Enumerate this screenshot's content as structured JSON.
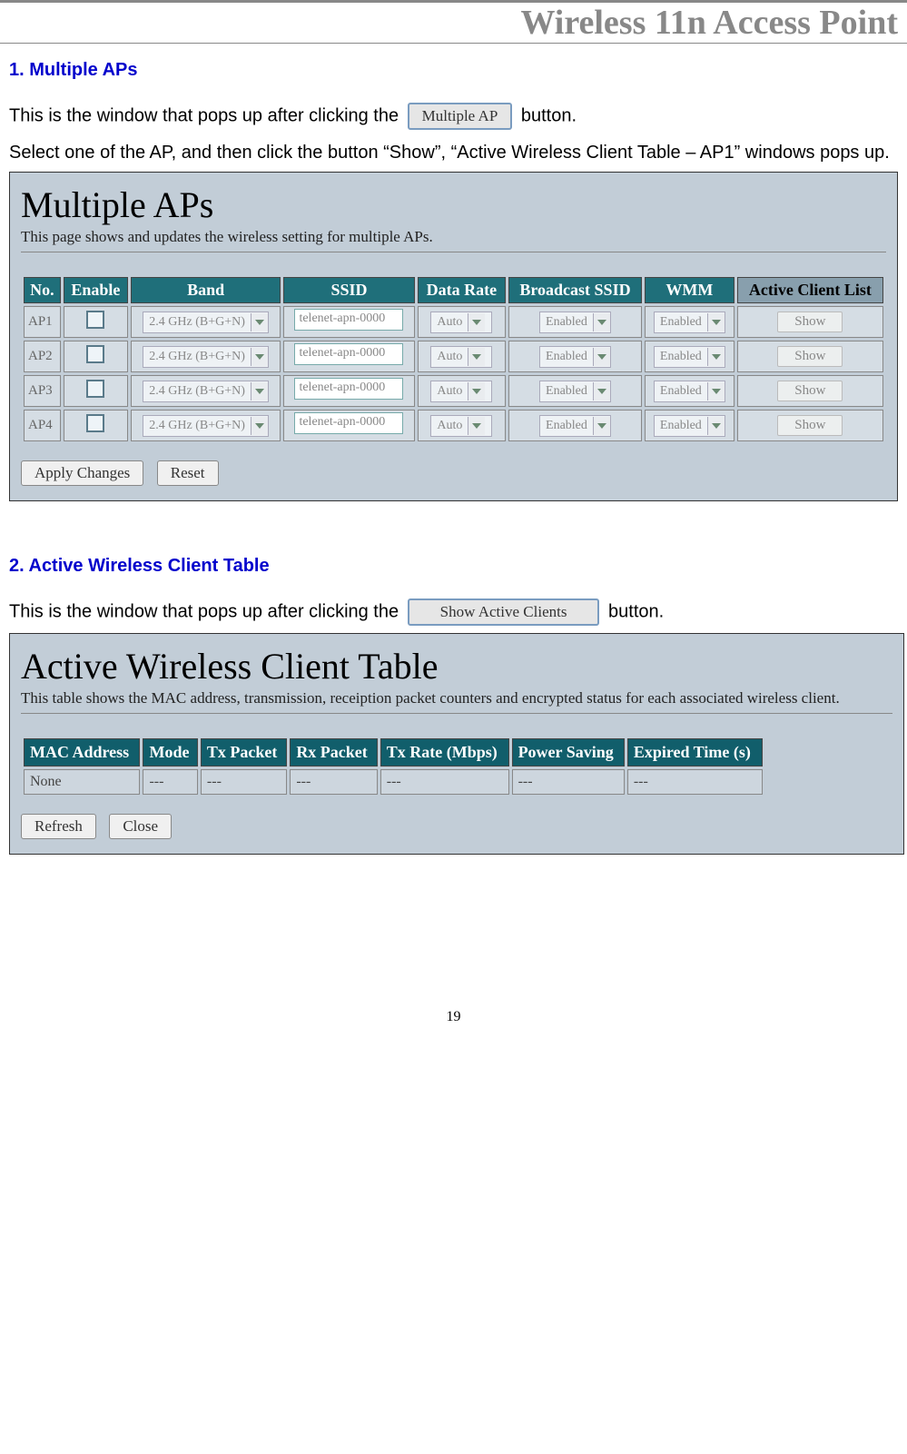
{
  "header": {
    "title": "Wireless 11n Access Point"
  },
  "section1": {
    "heading": "1. Multiple APs",
    "text_before_btn": "This is the window that pops up after clicking the ",
    "btn_label": "Multiple AP",
    "text_after_btn": " button.",
    "paragraph2": "Select one of the AP, and then click the button “Show”, “Active Wireless Client Table – AP1” windows pops up."
  },
  "multiple_aps": {
    "title": "Multiple APs",
    "desc": "This page shows and updates the wireless setting for multiple APs.",
    "headers": [
      "No.",
      "Enable",
      "Band",
      "SSID",
      "Data Rate",
      "Broadcast SSID",
      "WMM",
      "Active Client List"
    ],
    "rows": [
      {
        "no": "AP1",
        "band": "2.4 GHz (B+G+N)",
        "ssid": "telenet-apn-0000",
        "rate": "Auto",
        "bcast": "Enabled",
        "wmm": "Enabled",
        "show": "Show"
      },
      {
        "no": "AP2",
        "band": "2.4 GHz (B+G+N)",
        "ssid": "telenet-apn-0000",
        "rate": "Auto",
        "bcast": "Enabled",
        "wmm": "Enabled",
        "show": "Show"
      },
      {
        "no": "AP3",
        "band": "2.4 GHz (B+G+N)",
        "ssid": "telenet-apn-0000",
        "rate": "Auto",
        "bcast": "Enabled",
        "wmm": "Enabled",
        "show": "Show"
      },
      {
        "no": "AP4",
        "band": "2.4 GHz (B+G+N)",
        "ssid": "telenet-apn-0000",
        "rate": "Auto",
        "bcast": "Enabled",
        "wmm": "Enabled",
        "show": "Show"
      }
    ],
    "apply_label": "Apply Changes",
    "reset_label": "Reset"
  },
  "section2": {
    "heading": "2. Active Wireless Client Table",
    "text_before_btn": "This is the window that pops up after clicking the ",
    "btn_label": "Show Active Clients",
    "text_after_btn": " button."
  },
  "client_table": {
    "title": "Active Wireless Client Table",
    "desc": "This table shows the MAC address, transmission, receiption packet counters and encrypted status for each associated wireless client.",
    "headers": [
      "MAC Address",
      "Mode",
      "Tx Packet",
      "Rx Packet",
      "Tx Rate (Mbps)",
      "Power Saving",
      "Expired Time (s)"
    ],
    "row": {
      "mac": "None",
      "mode": "---",
      "tx": "---",
      "rx": "---",
      "rate": "---",
      "power": "---",
      "exp": "---"
    },
    "refresh_label": "Refresh",
    "close_label": "Close"
  },
  "page_number": "19"
}
